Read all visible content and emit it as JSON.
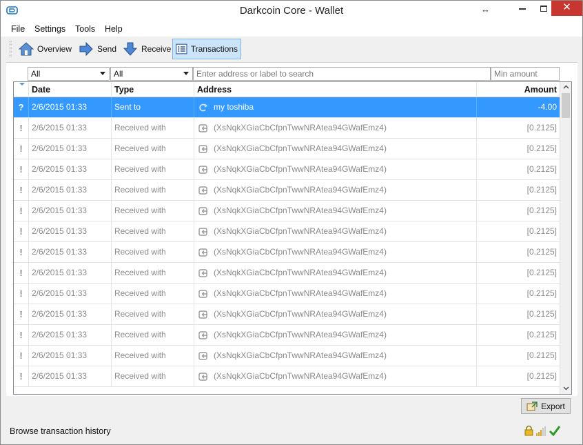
{
  "window": {
    "title": "Darkcoin Core - Wallet",
    "resize_glyph": "↔",
    "close_glyph": "✕"
  },
  "menu": {
    "items": [
      "File",
      "Settings",
      "Tools",
      "Help"
    ]
  },
  "toolbar": {
    "items": [
      {
        "label": "Overview",
        "icon": "home-icon"
      },
      {
        "label": "Send",
        "icon": "send-arrow-icon"
      },
      {
        "label": "Receive",
        "icon": "receive-arrow-icon"
      },
      {
        "label": "Transactions",
        "icon": "transactions-list-icon",
        "active": true
      }
    ]
  },
  "filters": {
    "date_value": "All",
    "type_value": "All",
    "search_placeholder": "Enter address or label to search",
    "min_amount_placeholder": "Min amount"
  },
  "table": {
    "headers": {
      "date": "Date",
      "type": "Type",
      "address": "Address",
      "amount": "Amount"
    },
    "rows": [
      {
        "status": "?",
        "date": "2/6/2015 01:33",
        "type": "Sent to",
        "address": "my toshiba",
        "amount": "-4.00",
        "selected": true
      },
      {
        "status": "!",
        "date": "2/6/2015 01:33",
        "type": "Received with",
        "address": "(XsNqkXGiaCbCfpnTwwNRAtea94GWafEmz4)",
        "amount": "[0.2125]"
      },
      {
        "status": "!",
        "date": "2/6/2015 01:33",
        "type": "Received with",
        "address": "(XsNqkXGiaCbCfpnTwwNRAtea94GWafEmz4)",
        "amount": "[0.2125]"
      },
      {
        "status": "!",
        "date": "2/6/2015 01:33",
        "type": "Received with",
        "address": "(XsNqkXGiaCbCfpnTwwNRAtea94GWafEmz4)",
        "amount": "[0.2125]"
      },
      {
        "status": "!",
        "date": "2/6/2015 01:33",
        "type": "Received with",
        "address": "(XsNqkXGiaCbCfpnTwwNRAtea94GWafEmz4)",
        "amount": "[0.2125]"
      },
      {
        "status": "!",
        "date": "2/6/2015 01:33",
        "type": "Received with",
        "address": "(XsNqkXGiaCbCfpnTwwNRAtea94GWafEmz4)",
        "amount": "[0.2125]"
      },
      {
        "status": "!",
        "date": "2/6/2015 01:33",
        "type": "Received with",
        "address": "(XsNqkXGiaCbCfpnTwwNRAtea94GWafEmz4)",
        "amount": "[0.2125]"
      },
      {
        "status": "!",
        "date": "2/6/2015 01:33",
        "type": "Received with",
        "address": "(XsNqkXGiaCbCfpnTwwNRAtea94GWafEmz4)",
        "amount": "[0.2125]"
      },
      {
        "status": "!",
        "date": "2/6/2015 01:33",
        "type": "Received with",
        "address": "(XsNqkXGiaCbCfpnTwwNRAtea94GWafEmz4)",
        "amount": "[0.2125]"
      },
      {
        "status": "!",
        "date": "2/6/2015 01:33",
        "type": "Received with",
        "address": "(XsNqkXGiaCbCfpnTwwNRAtea94GWafEmz4)",
        "amount": "[0.2125]"
      },
      {
        "status": "!",
        "date": "2/6/2015 01:33",
        "type": "Received with",
        "address": "(XsNqkXGiaCbCfpnTwwNRAtea94GWafEmz4)",
        "amount": "[0.2125]"
      },
      {
        "status": "!",
        "date": "2/6/2015 01:33",
        "type": "Received with",
        "address": "(XsNqkXGiaCbCfpnTwwNRAtea94GWafEmz4)",
        "amount": "[0.2125]"
      },
      {
        "status": "!",
        "date": "2/6/2015 01:33",
        "type": "Received with",
        "address": "(XsNqkXGiaCbCfpnTwwNRAtea94GWafEmz4)",
        "amount": "[0.2125]"
      },
      {
        "status": "!",
        "date": "2/6/2015 01:33",
        "type": "Received with",
        "address": "(XsNqkXGiaCbCfpnTwwNRAtea94GWafEmz4)",
        "amount": "[0.2125]"
      }
    ]
  },
  "export_label": "Export",
  "statusbar": {
    "text": "Browse transaction history",
    "icons": [
      "lock-icon",
      "signal-bars-icon",
      "synced-check-icon"
    ]
  },
  "colors": {
    "selection": "#3399ff",
    "active_tab": "#cce4f7",
    "close_button": "#c7372f",
    "muted_text": "#8a8a8a"
  }
}
